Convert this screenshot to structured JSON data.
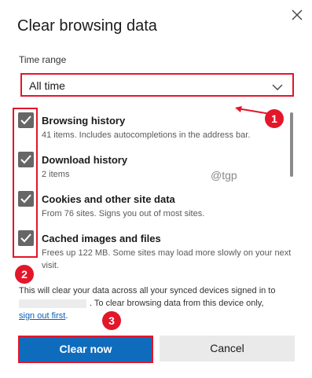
{
  "dialog": {
    "title": "Clear browsing data",
    "time_range_label": "Time range",
    "time_range_value": "All time",
    "items": [
      {
        "title": "Browsing history",
        "desc": "41 items. Includes autocompletions in the address bar.",
        "checked": true
      },
      {
        "title": "Download history",
        "desc": "2 items",
        "checked": true
      },
      {
        "title": "Cookies and other site data",
        "desc": "From 76 sites. Signs you out of most sites.",
        "checked": true
      },
      {
        "title": "Cached images and files",
        "desc": "Frees up 122 MB. Some sites may load more slowly on your next visit.",
        "checked": true
      }
    ],
    "info_text_1": "This will clear your data across all your synced devices signed in to",
    "info_text_2": ". To clear browsing data from this device only,",
    "sign_out_link": "sign out first",
    "sign_out_period": ".",
    "clear_button": "Clear now",
    "cancel_button": "Cancel"
  },
  "watermark": "@tgp",
  "annotations": {
    "badge_1": "1",
    "badge_2": "2",
    "badge_3": "3",
    "highlight_color": "#e3162a"
  },
  "colors": {
    "accent": "#0f6cbd",
    "checkbox": "#666666",
    "link": "#0b5fb8"
  }
}
